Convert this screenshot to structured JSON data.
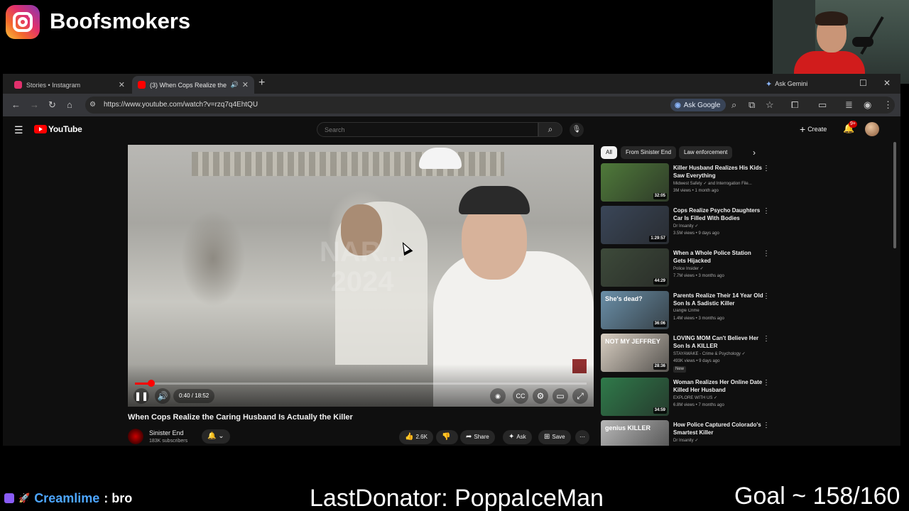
{
  "overlay": {
    "ig_handle": "Boofsmokers",
    "chat_user": "Creamlime",
    "chat_message": ": bro",
    "last_donator": "LastDonator: PoppaIceMan",
    "goal": "Goal ~ 158/160"
  },
  "browser": {
    "tabs": [
      {
        "label": "Stories • Instagram",
        "favicon_color": "#e1306c"
      },
      {
        "label": "(3) When Cops Realize the",
        "favicon_color": "#ff0000"
      }
    ],
    "gemini_label": "Ask Gemini",
    "url": "https://www.youtube.com/watch?v=rzq7q4EhtQU",
    "ask_google_label": "Ask Google"
  },
  "youtube": {
    "logo_text": "YouTube",
    "search_placeholder": "Search",
    "create_label": "Create",
    "notification_count": "9+",
    "player": {
      "progress_fraction": 0.036,
      "time": "0:40 / 18:52",
      "watermark": "NAR... 2024"
    },
    "video": {
      "title": "When Cops Realize the Caring Husband Is Actually the Killer",
      "channel": "Sinister End",
      "subscribers": "183K subscribers",
      "likes": "2.6K",
      "share_label": "Share",
      "ask_label": "Ask",
      "save_label": "Save"
    },
    "chips": [
      "All",
      "From Sinister End",
      "Law enforcement"
    ],
    "recommendations": [
      {
        "title": "Killer Husband Realizes His Kids Saw Everything",
        "channel": "Midwest Safety ✓ and Interrogation File...",
        "meta": "3M views • 1 month ago",
        "duration": "32:05",
        "thumb_color": "#4f7a3a"
      },
      {
        "title": "Cops Realize Psycho Daughters Car Is Filled With Bodies",
        "channel": "Dr Insanity ✓",
        "meta": "3.5M views • 9 days ago",
        "duration": "1:29:57",
        "thumb_color": "#3a4658"
      },
      {
        "title": "When a Whole Police Station Gets Hijacked",
        "channel": "Police Insider ✓",
        "meta": "7.7M views • 3 months ago",
        "duration": "44:29",
        "thumb_color": "#3d4a3a"
      },
      {
        "title": "Parents Realize Their 14 Year Old Son Is A Sadistic Killer",
        "channel": "Dangle Crime",
        "meta": "1.4M views • 3 months ago",
        "duration": "36:06",
        "thumb_color": "#6a8fa8",
        "thumb_text": "She's dead?"
      },
      {
        "title": "LOVING MOM Can't Believe Her Son Is A KILLER",
        "channel": "STAYAWAKE - Crime & Psychology ✓",
        "meta": "493K views • 9 days ago",
        "duration": "28:36",
        "thumb_color": "#d9cfc2",
        "thumb_text": "NOT MY JEFFREY",
        "badge": "New"
      },
      {
        "title": "Woman Realizes Her Online Date Killed Her Husband",
        "channel": "EXPLORE WITH US ✓",
        "meta": "6.8M views • 7 months ago",
        "duration": "34:59",
        "thumb_color": "#2f7a4a"
      },
      {
        "title": "How Police Captured Colorado's Smartest Killer",
        "channel": "Dr Insanity ✓",
        "meta": "",
        "duration": "",
        "thumb_color": "#b8b8b8",
        "thumb_text": "genius KILLER"
      }
    ]
  }
}
